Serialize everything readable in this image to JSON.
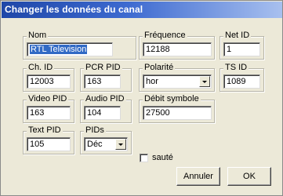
{
  "dialog": {
    "title": "Changer les données du canal"
  },
  "fields": {
    "nom": {
      "label": "Nom",
      "value": "RTL Television"
    },
    "frequence": {
      "label": "Fréquence",
      "value": "12188"
    },
    "net_id": {
      "label": "Net ID",
      "value": "1"
    },
    "ch_id": {
      "label": "Ch. ID",
      "value": "12003"
    },
    "pcr_pid": {
      "label": "PCR PID",
      "value": "163"
    },
    "polarite": {
      "label": "Polarité",
      "value": "hor"
    },
    "ts_id": {
      "label": "TS ID",
      "value": "1089"
    },
    "video_pid": {
      "label": "Video PID",
      "value": "163"
    },
    "audio_pid": {
      "label": "Audio PID",
      "value": "104"
    },
    "debit_symbole": {
      "label": "Débit symbole",
      "value": "27500"
    },
    "text_pid": {
      "label": "Text PID",
      "value": "105"
    },
    "pids": {
      "label": "PIDs",
      "value": "Déc"
    }
  },
  "sauté": {
    "label": "sauté",
    "checked": false
  },
  "buttons": {
    "cancel": "Annuler",
    "ok": "OK"
  }
}
